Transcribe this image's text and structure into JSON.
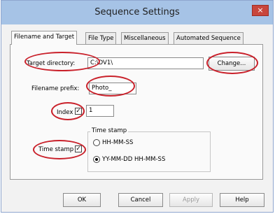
{
  "window": {
    "title": "Sequence Settings",
    "close_glyph": "×"
  },
  "tabs": [
    {
      "label": "Filename and Target",
      "active": true
    },
    {
      "label": "File Type",
      "active": false
    },
    {
      "label": "Miscellaneous",
      "active": false
    },
    {
      "label": "Automated Sequence",
      "active": false
    }
  ],
  "target": {
    "label": "Target directory:",
    "value": "C:\\DV1\\",
    "button": "Change..."
  },
  "prefix": {
    "label": "Filename prefix:",
    "value": "Photo_"
  },
  "index": {
    "label": "Index",
    "checked": true,
    "value": "1"
  },
  "timestamp": {
    "label": "Time stamp",
    "checked": true,
    "group_title": "Time stamp",
    "options": [
      {
        "label": "HH-MM-SS",
        "selected": false
      },
      {
        "label": "YY-MM-DD HH-MM-SS",
        "selected": true
      }
    ]
  },
  "buttons": {
    "ok": "OK",
    "cancel": "Cancel",
    "apply": "Apply",
    "help": "Help"
  },
  "glyphs": {
    "check": "✓"
  },
  "colors": {
    "titlebar": "#a6c3e6",
    "close": "#c8463c",
    "annotation": "#c9202a"
  }
}
